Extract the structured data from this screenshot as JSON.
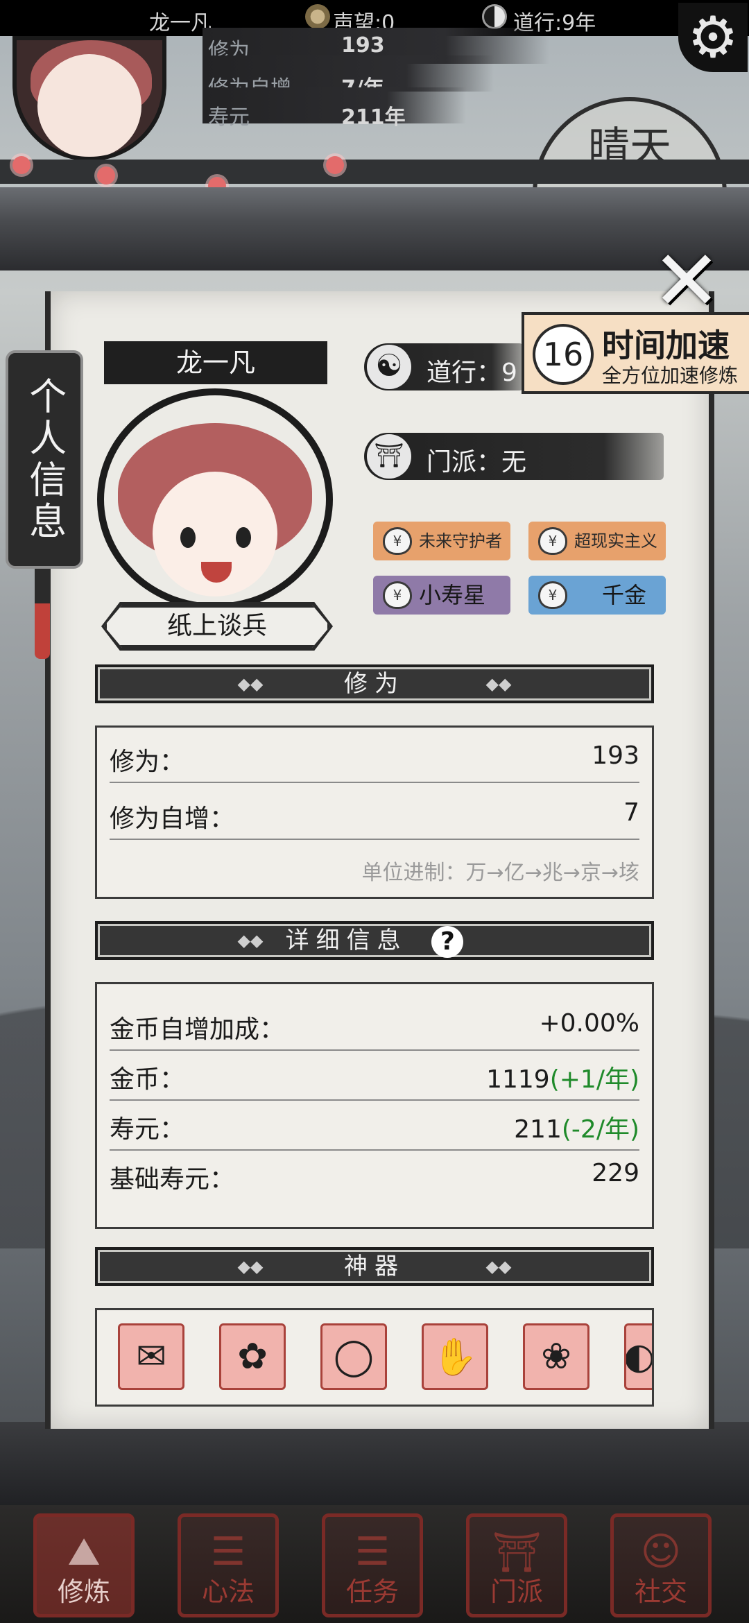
{
  "topbar": {
    "player_name": "龙一凡",
    "fame": "声望:0",
    "dao_years": "道行:9年",
    "settings_icon": "gear-icon"
  },
  "header": {
    "rows": [
      {
        "label": "修为",
        "value": "193"
      },
      {
        "label": "修为自增",
        "value": "7/年"
      },
      {
        "label": "寿元",
        "value": "211年"
      }
    ],
    "weather": "晴天"
  },
  "speed_up": {
    "count": "16",
    "title": "时间加速",
    "subtitle": "全方位加速修炼"
  },
  "panel": {
    "side_tab": "个人信息",
    "name": "龙一凡",
    "title_badge": "纸上谈兵",
    "dao": "道行：9",
    "sect": "门派：无",
    "tags": [
      "未来守护者",
      "超现实主义",
      "小寿星",
      "千金"
    ],
    "cultivation": {
      "header": "修为",
      "rows": [
        {
          "label": "修为：",
          "value": "193"
        },
        {
          "label": "修为自增：",
          "value": "7"
        }
      ],
      "unit_note": "单位进制：万→亿→兆→京→垓"
    },
    "details": {
      "header": "详细信息",
      "rows": [
        {
          "label": "金币自增加成：",
          "value": "+0.00%",
          "extra": ""
        },
        {
          "label": "金币：",
          "value": "1119",
          "extra": "(+1/年)"
        },
        {
          "label": "寿元：",
          "value": "211",
          "extra": "(-2/年)"
        },
        {
          "label": "基础寿元：",
          "value": "229",
          "extra": ""
        }
      ]
    },
    "artifacts": {
      "header": "神器",
      "items": [
        "pouch-icon",
        "fan-icon",
        "bracelet-icon",
        "gauntlet-icon",
        "bonsai-icon",
        "mirror-icon"
      ]
    }
  },
  "nav": [
    {
      "label": "修炼",
      "icon": "mountain-icon",
      "active": true
    },
    {
      "label": "心法",
      "icon": "scroll-icon",
      "active": false
    },
    {
      "label": "任务",
      "icon": "scroll-icon",
      "active": false
    },
    {
      "label": "门派",
      "icon": "gate-icon",
      "active": false
    },
    {
      "label": "社交",
      "icon": "people-icon",
      "active": false
    }
  ],
  "colors": {
    "accent_red": "#a9423b",
    "positive_green": "#1f8a2a",
    "panel_bg": "#ecebe6",
    "ink": "#1f1f1f"
  }
}
